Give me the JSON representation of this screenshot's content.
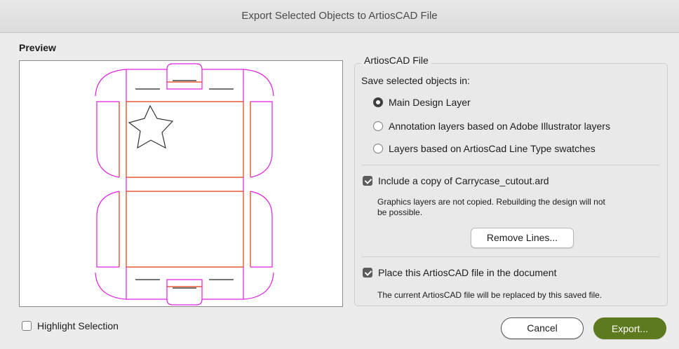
{
  "window": {
    "title": "Export Selected Objects to ArtiosCAD File"
  },
  "preview": {
    "label": "Preview"
  },
  "artios_group": {
    "title": "ArtiosCAD File",
    "save_in_label": "Save selected objects in:",
    "options": [
      {
        "label": "Main Design Layer",
        "selected": true
      },
      {
        "label": "Annotation layers based on Adobe Illustrator layers",
        "selected": false
      },
      {
        "label": "Layers based on ArtiosCad Line Type swatches",
        "selected": false
      }
    ],
    "include_copy": {
      "label": "Include a copy of Carrycase_cutout.ard",
      "checked": true,
      "note_line1": "Graphics layers are not copied.  Rebuilding the design will not",
      "note_line2": "be possible."
    },
    "remove_lines_button": "Remove Lines...",
    "place_file": {
      "label": "Place this ArtiosCAD file in the document",
      "checked": true,
      "note": "The current ArtiosCAD file will be replaced by this saved file."
    }
  },
  "highlight_selection": {
    "label": "Highlight Selection",
    "checked": false
  },
  "buttons": {
    "cancel": "Cancel",
    "export": "Export..."
  },
  "colors": {
    "cut_line": "#e020e0",
    "crease_line": "#e03a10",
    "export_button": "#5d7a1f"
  }
}
